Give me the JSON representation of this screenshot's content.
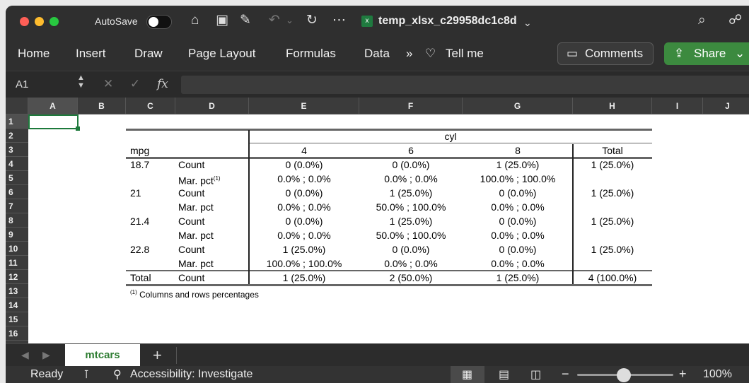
{
  "titlebar": {
    "autosave": "AutoSave",
    "doc_title": "temp_xlsx_c29958dc1c8d",
    "doc_chevron": "⌄"
  },
  "ribbon": {
    "tabs": [
      "Home",
      "Insert",
      "Draw",
      "Page Layout",
      "Formulas",
      "Data"
    ],
    "more": "»",
    "tell_me": "Tell me",
    "comments": "Comments",
    "share": "Share"
  },
  "formula_bar": {
    "name_box": "A1",
    "fx": "fx",
    "value": ""
  },
  "columns": [
    "A",
    "B",
    "C",
    "D",
    "E",
    "F",
    "G",
    "H",
    "I",
    "J"
  ],
  "rows": [
    "1",
    "2",
    "3",
    "4",
    "5",
    "6",
    "7",
    "8",
    "9",
    "10",
    "11",
    "12",
    "13",
    "14",
    "15",
    "16"
  ],
  "table": {
    "group_header": "cyl",
    "row_var": "mpg",
    "col_heads": [
      "4",
      "6",
      "8",
      "Total"
    ],
    "rows": [
      {
        "mpg": "18.7",
        "stat": "Count",
        "v": [
          "0 (0.0%)",
          "0 (0.0%)",
          "1 (25.0%)",
          "1 (25.0%)"
        ]
      },
      {
        "mpg": "",
        "stat": "Mar. pct",
        "sup": "(1)",
        "v": [
          "0.0% ; 0.0%",
          "0.0% ; 0.0%",
          "100.0% ; 100.0%",
          ""
        ]
      },
      {
        "mpg": "21",
        "stat": "Count",
        "v": [
          "0 (0.0%)",
          "1 (25.0%)",
          "0 (0.0%)",
          "1 (25.0%)"
        ]
      },
      {
        "mpg": "",
        "stat": "Mar. pct",
        "v": [
          "0.0% ; 0.0%",
          "50.0% ; 100.0%",
          "0.0% ; 0.0%",
          ""
        ]
      },
      {
        "mpg": "21.4",
        "stat": "Count",
        "v": [
          "0 (0.0%)",
          "1 (25.0%)",
          "0 (0.0%)",
          "1 (25.0%)"
        ]
      },
      {
        "mpg": "",
        "stat": "Mar. pct",
        "v": [
          "0.0% ; 0.0%",
          "50.0% ; 100.0%",
          "0.0% ; 0.0%",
          ""
        ]
      },
      {
        "mpg": "22.8",
        "stat": "Count",
        "v": [
          "1 (25.0%)",
          "0 (0.0%)",
          "0 (0.0%)",
          "1 (25.0%)"
        ]
      },
      {
        "mpg": "",
        "stat": "Mar. pct",
        "v": [
          "100.0% ; 100.0%",
          "0.0% ; 0.0%",
          "0.0% ; 0.0%",
          ""
        ]
      },
      {
        "mpg": "Total",
        "stat": "Count",
        "v": [
          "1 (25.0%)",
          "2 (50.0%)",
          "1 (25.0%)",
          "4 (100.0%)"
        ]
      }
    ],
    "footnote_mark": "(1)",
    "footnote": "Columns and rows percentages"
  },
  "sheet_tabs": {
    "active": "mtcars",
    "add": "+"
  },
  "status": {
    "ready": "Ready",
    "accessibility": "Accessibility: Investigate",
    "zoom": "100%",
    "minus": "−",
    "plus": "+"
  },
  "colors": {
    "accent_green": "#3c8a3f",
    "sheet_tab_text": "#2e7d32"
  }
}
